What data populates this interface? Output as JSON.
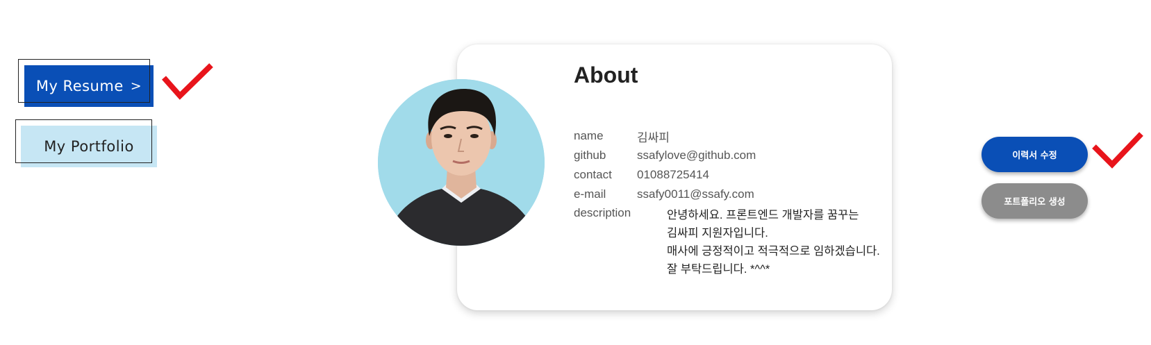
{
  "nav": {
    "resume_label": "My Resume",
    "resume_chevron": ">",
    "portfolio_label": "My Portfolio"
  },
  "about": {
    "title": "About",
    "fields": [
      {
        "key": "name",
        "value": "김싸피"
      },
      {
        "key": "github",
        "value": "ssafylove@github.com"
      },
      {
        "key": "contact",
        "value": "01088725414"
      },
      {
        "key": "e-mail",
        "value": "ssafy0011@ssafy.com"
      }
    ],
    "description_label": "description",
    "description_lines": [
      "안녕하세요. 프론트엔드 개발자를 꿈꾸는",
      "김싸피 지원자입니다.",
      "매사에 긍정적이고 적극적으로 임하겠습니다.",
      "잘 부탁드립니다. *^^*"
    ]
  },
  "actions": {
    "edit_resume_label": "이력서 수정",
    "create_portfolio_label": "포트폴리오 생성"
  },
  "colors": {
    "primary": "#0a4fb6",
    "light_blue": "#c6e6f4",
    "gray_button": "#8c8c8c",
    "check_red": "#e8141b",
    "avatar_bg": "#a1dbea"
  },
  "icons": [
    "red-checkmark-icon",
    "chevron-right-icon"
  ]
}
